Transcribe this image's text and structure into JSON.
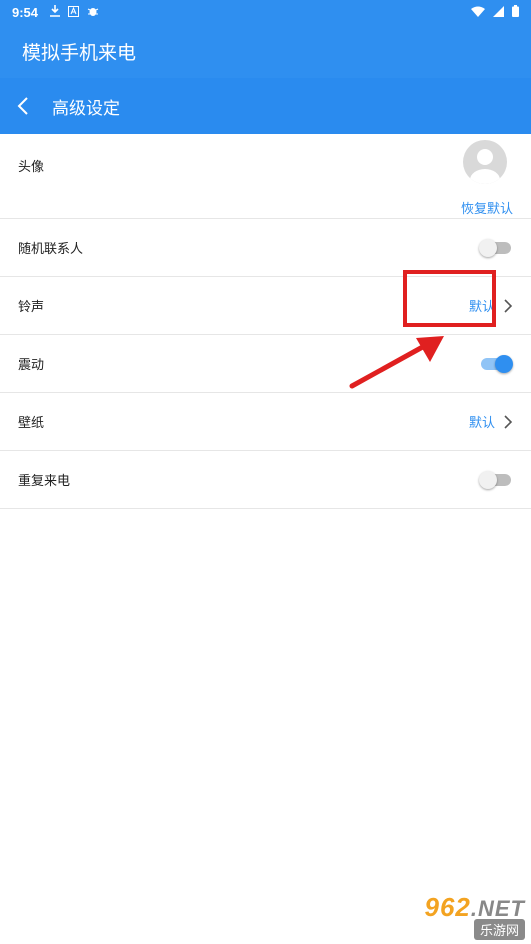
{
  "status_bar": {
    "time": "9:54",
    "icons": [
      "download-icon",
      "notification-a-icon",
      "bug-icon"
    ],
    "right_icons": [
      "wifi-icon",
      "signal-icon",
      "battery-icon"
    ]
  },
  "app_bar": {
    "title": "模拟手机来电"
  },
  "sub_bar": {
    "title": "高级设定"
  },
  "settings": {
    "avatar": {
      "label": "头像",
      "restore_label": "恢复默认"
    },
    "random_contact": {
      "label": "随机联系人",
      "enabled": false
    },
    "ringtone": {
      "label": "铃声",
      "value": "默认"
    },
    "vibrate": {
      "label": "震动",
      "enabled": true
    },
    "wallpaper": {
      "label": "壁纸",
      "value": "默认"
    },
    "repeat_call": {
      "label": "重复来电",
      "enabled": false
    }
  },
  "watermark": {
    "top_main": "962",
    "top_suffix": ".NET",
    "bottom": "乐游网"
  },
  "colors": {
    "primary": "#2f8ff0",
    "annotation": "#e02020"
  }
}
